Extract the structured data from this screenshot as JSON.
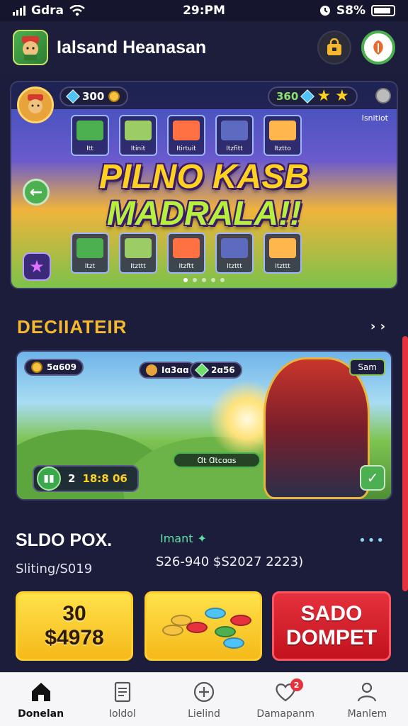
{
  "status_bar": {
    "carrier": "Gdra",
    "time": "29:PM",
    "battery_text": "S8%",
    "battery_level": 0.9
  },
  "header": {
    "title": "Ialsand Heanasan"
  },
  "banner": {
    "currency_amount": "300",
    "gem_amount": "360",
    "corner_label": "Isnitiot",
    "promo_line1": "PILNO KASB",
    "promo_line2": "MADRALA!!",
    "top_cards": [
      "Itt",
      "Itinit",
      "Itirtuit",
      "Itzfitt",
      "Itztto"
    ],
    "bottom_cards": [
      "Itzt",
      "Itzttt",
      "Itzftt",
      "Itzttt",
      "Itzttt"
    ],
    "slide_count": 5,
    "active_slide": 0
  },
  "section": {
    "title": "DECIIATEIR",
    "more": "› ›"
  },
  "event": {
    "score_pill": "5ɑ609",
    "player_pill": "Iɑ3ɑɑ",
    "points_pill": "2ɑ56",
    "chip_label": "Sam",
    "timer_num": "2",
    "timer_text": "18:8 06",
    "progress_label": "Ɑt Ɑtcɑɑs"
  },
  "balance": {
    "title": "SLDO POX.",
    "subtitle": "Sliting/S019",
    "import_label": "Imant",
    "amounts": "S26-940 $S2027 2223)",
    "more": "•••"
  },
  "tiles": {
    "yellow_line1": "30",
    "yellow_line2": "$4978",
    "red_line1": "SADO",
    "red_line2": "DOMPET"
  },
  "tabs": [
    {
      "label": "Donelan",
      "icon": "home-icon"
    },
    {
      "label": "Ioldol",
      "icon": "document-icon"
    },
    {
      "label": "Lielind",
      "icon": "plus-circle-icon"
    },
    {
      "label": "Damapanm",
      "icon": "heart-icon",
      "badge": "2"
    },
    {
      "label": "Manlem",
      "icon": "user-icon"
    }
  ],
  "colors": {
    "accent_yellow": "#f5b82e",
    "accent_red": "#e5323d",
    "accent_green": "#4caf50",
    "background": "#1c1d3a"
  }
}
